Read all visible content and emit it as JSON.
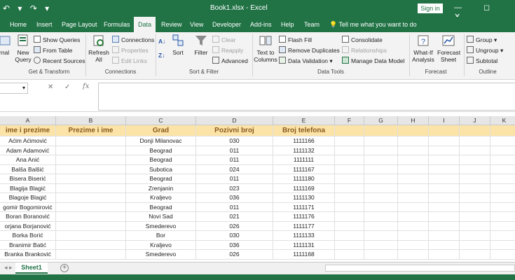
{
  "titlebar": {
    "qat": "↶ ▾ ↷ ▾",
    "title": "Book1.xlsx - Excel",
    "signin": "Sign in",
    "controls": "— ◻ ✕"
  },
  "tabs": [
    "Home",
    "Insert",
    "Page Layout",
    "Formulas",
    "Data",
    "Review",
    "View",
    "Developer",
    "Add-ins",
    "Help",
    "Team"
  ],
  "active_tab": "Data",
  "tellme": "Tell me what you want to do",
  "ribbon": {
    "get_transform": {
      "label": "Get & Transform",
      "partial_btn": "rnal",
      "new_query": "New Query",
      "show_queries": "Show Queries",
      "from_table": "From Table",
      "recent_sources": "Recent Sources"
    },
    "connections": {
      "label": "Connections",
      "refresh_all": "Refresh All",
      "connections": "Connections",
      "properties": "Properties",
      "edit_links": "Edit Links"
    },
    "sort_filter": {
      "label": "Sort & Filter",
      "sort": "Sort",
      "filter": "Filter",
      "clear": "Clear",
      "reapply": "Reapply",
      "advanced": "Advanced"
    },
    "data_tools": {
      "label": "Data Tools",
      "text_to_columns": "Text to Columns",
      "flash_fill": "Flash Fill",
      "remove_duplicates": "Remove Duplicates",
      "data_validation": "Data Validation",
      "consolidate": "Consolidate",
      "relationships": "Relationships",
      "manage_data_model": "Manage Data Model"
    },
    "forecast": {
      "label": "Forecast",
      "what_if": "What-If Analysis",
      "forecast_sheet": "Forecast Sheet"
    },
    "outline": {
      "label": "Outline",
      "group": "Group",
      "ungroup": "Ungroup",
      "subtotal": "Subtotal"
    }
  },
  "formula_bar": {
    "name_box": "▾",
    "cancel": "✕",
    "enter": "✓",
    "fx": "fx",
    "value": ""
  },
  "columns": [
    "A",
    "B",
    "C",
    "D",
    "E",
    "F",
    "G",
    "H",
    "I",
    "J",
    "K"
  ],
  "headers": [
    "ime i prezime",
    "Prezime i ime",
    "Grad",
    "Pozivni broj",
    "Broj telefona"
  ],
  "rows": [
    [
      "Aćim Aćimović",
      "",
      "Donji Milanovac",
      "030",
      "1111166"
    ],
    [
      "Adam Adamović",
      "",
      "Beograd",
      "011",
      "1111132"
    ],
    [
      "Ana Anić",
      "",
      "Beograd",
      "011",
      "1111111"
    ],
    [
      "Balša Balšić",
      "",
      "Subotica",
      "024",
      "1111167"
    ],
    [
      "Bisera Biserić",
      "",
      "Beograd",
      "011",
      "1111180"
    ],
    [
      "Blagija Blagić",
      "",
      "Zrenjanin",
      "023",
      "1111169"
    ],
    [
      "Blagoje Blagić",
      "",
      "Kraljevo",
      "036",
      "1111130"
    ],
    [
      "gomir Bogomirović",
      "",
      "Beograd",
      "011",
      "1111171"
    ],
    [
      "Boran Boranović",
      "",
      "Novi Sad",
      "021",
      "1111176"
    ],
    [
      "orjana Borjanović",
      "",
      "Smederevo",
      "026",
      "1111177"
    ],
    [
      "Borka Borić",
      "",
      "Bor",
      "030",
      "1111133"
    ],
    [
      "Branimir Batić",
      "",
      "Kraljevo",
      "036",
      "1111131"
    ],
    [
      "Branka Branković",
      "",
      "Smederevo",
      "026",
      "1111168"
    ]
  ],
  "sheet": {
    "name": "Sheet1",
    "add": "+"
  },
  "colors": {
    "accent": "#217346",
    "header_fill": "#fce4a8",
    "header_text": "#8b5a1e"
  }
}
